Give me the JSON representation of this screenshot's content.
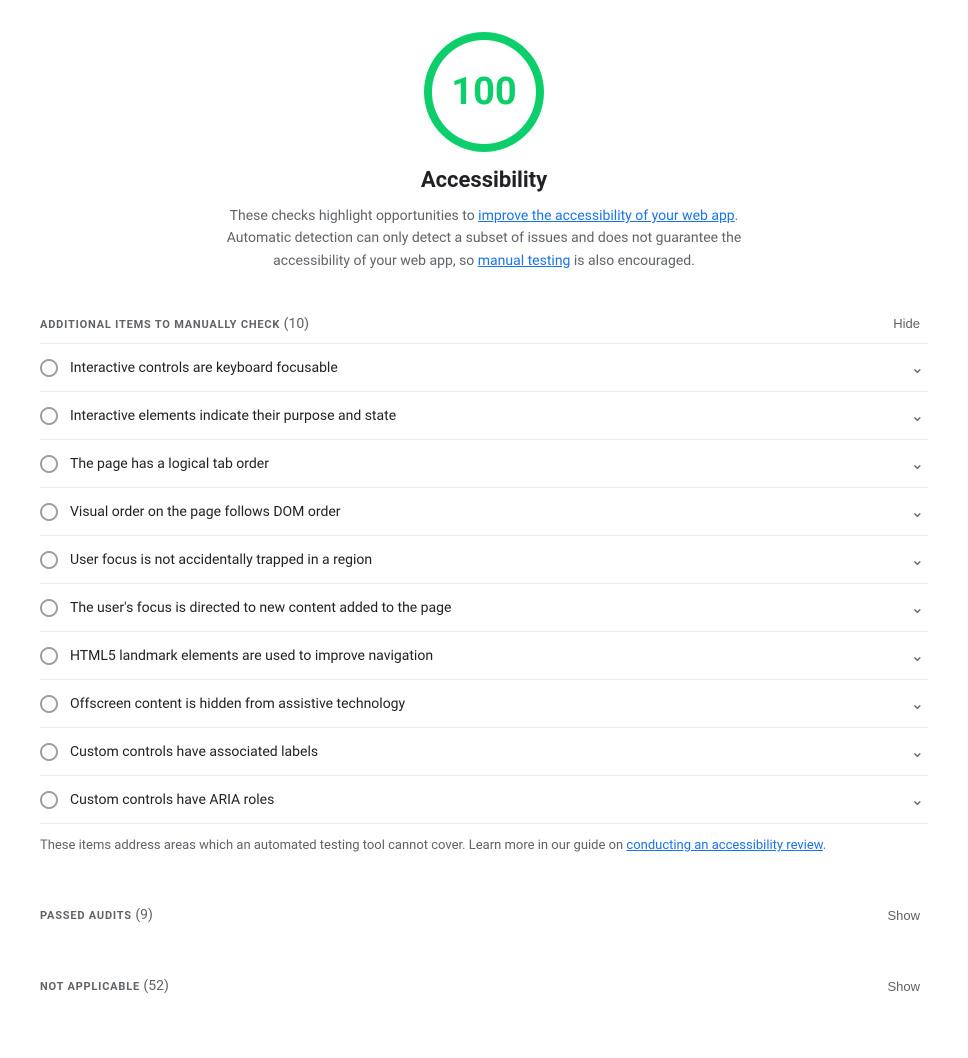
{
  "score": {
    "value": "100",
    "color": "#0cce6b",
    "title": "Accessibility",
    "description_before": "These checks highlight opportunities to ",
    "link1_text": "improve the accessibility of your web app",
    "link1_href": "#",
    "description_middle": ". Automatic detection can only detect a subset of issues and does not guarantee the accessibility of your web app, so ",
    "link2_text": "manual testing",
    "link2_href": "#",
    "description_after": " is also encouraged."
  },
  "manual_section": {
    "title": "ADDITIONAL ITEMS TO MANUALLY CHECK",
    "count": "(10)",
    "toggle_label": "Hide"
  },
  "audit_items": [
    {
      "id": "item-1",
      "label": "Interactive controls are keyboard focusable"
    },
    {
      "id": "item-2",
      "label": "Interactive elements indicate their purpose and state"
    },
    {
      "id": "item-3",
      "label": "The page has a logical tab order"
    },
    {
      "id": "item-4",
      "label": "Visual order on the page follows DOM order"
    },
    {
      "id": "item-5",
      "label": "User focus is not accidentally trapped in a region"
    },
    {
      "id": "item-6",
      "label": "The user's focus is directed to new content added to the page"
    },
    {
      "id": "item-7",
      "label": "HTML5 landmark elements are used to improve navigation"
    },
    {
      "id": "item-8",
      "label": "Offscreen content is hidden from assistive technology"
    },
    {
      "id": "item-9",
      "label": "Custom controls have associated labels"
    },
    {
      "id": "item-10",
      "label": "Custom controls have ARIA roles"
    }
  ],
  "manual_note_before": "These items address areas which an automated testing tool cannot cover. Learn more in our guide on ",
  "manual_note_link_text": "conducting an accessibility review",
  "manual_note_link_href": "#",
  "manual_note_after": ".",
  "passed_section": {
    "title": "PASSED AUDITS",
    "count": "(9)",
    "toggle_label": "Show"
  },
  "not_applicable_section": {
    "title": "NOT APPLICABLE",
    "count": "(52)",
    "toggle_label": "Show"
  },
  "chevron_down": "∨"
}
